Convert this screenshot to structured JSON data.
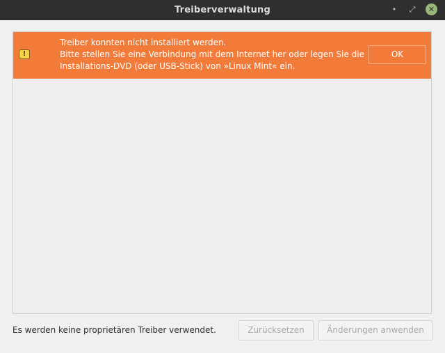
{
  "window": {
    "title": "Treiberverwaltung",
    "controls": {
      "minimize": "•",
      "maximize": "⤢",
      "close": "✕"
    }
  },
  "infobar": {
    "icon": "!",
    "lines": [
      "Treiber konnten nicht installiert werden.",
      "Bitte stellen Sie eine Verbindung mit dem Internet her oder legen Sie die",
      "Installations-DVD (oder USB-Stick) von »Linux Mint« ein."
    ],
    "ok_label": "OK",
    "background": "#f27b3a"
  },
  "footer": {
    "status": "Es werden keine proprietären Treiber verwendet.",
    "reset_label": "Zurücksetzen",
    "apply_label": "Änderungen anwenden"
  }
}
